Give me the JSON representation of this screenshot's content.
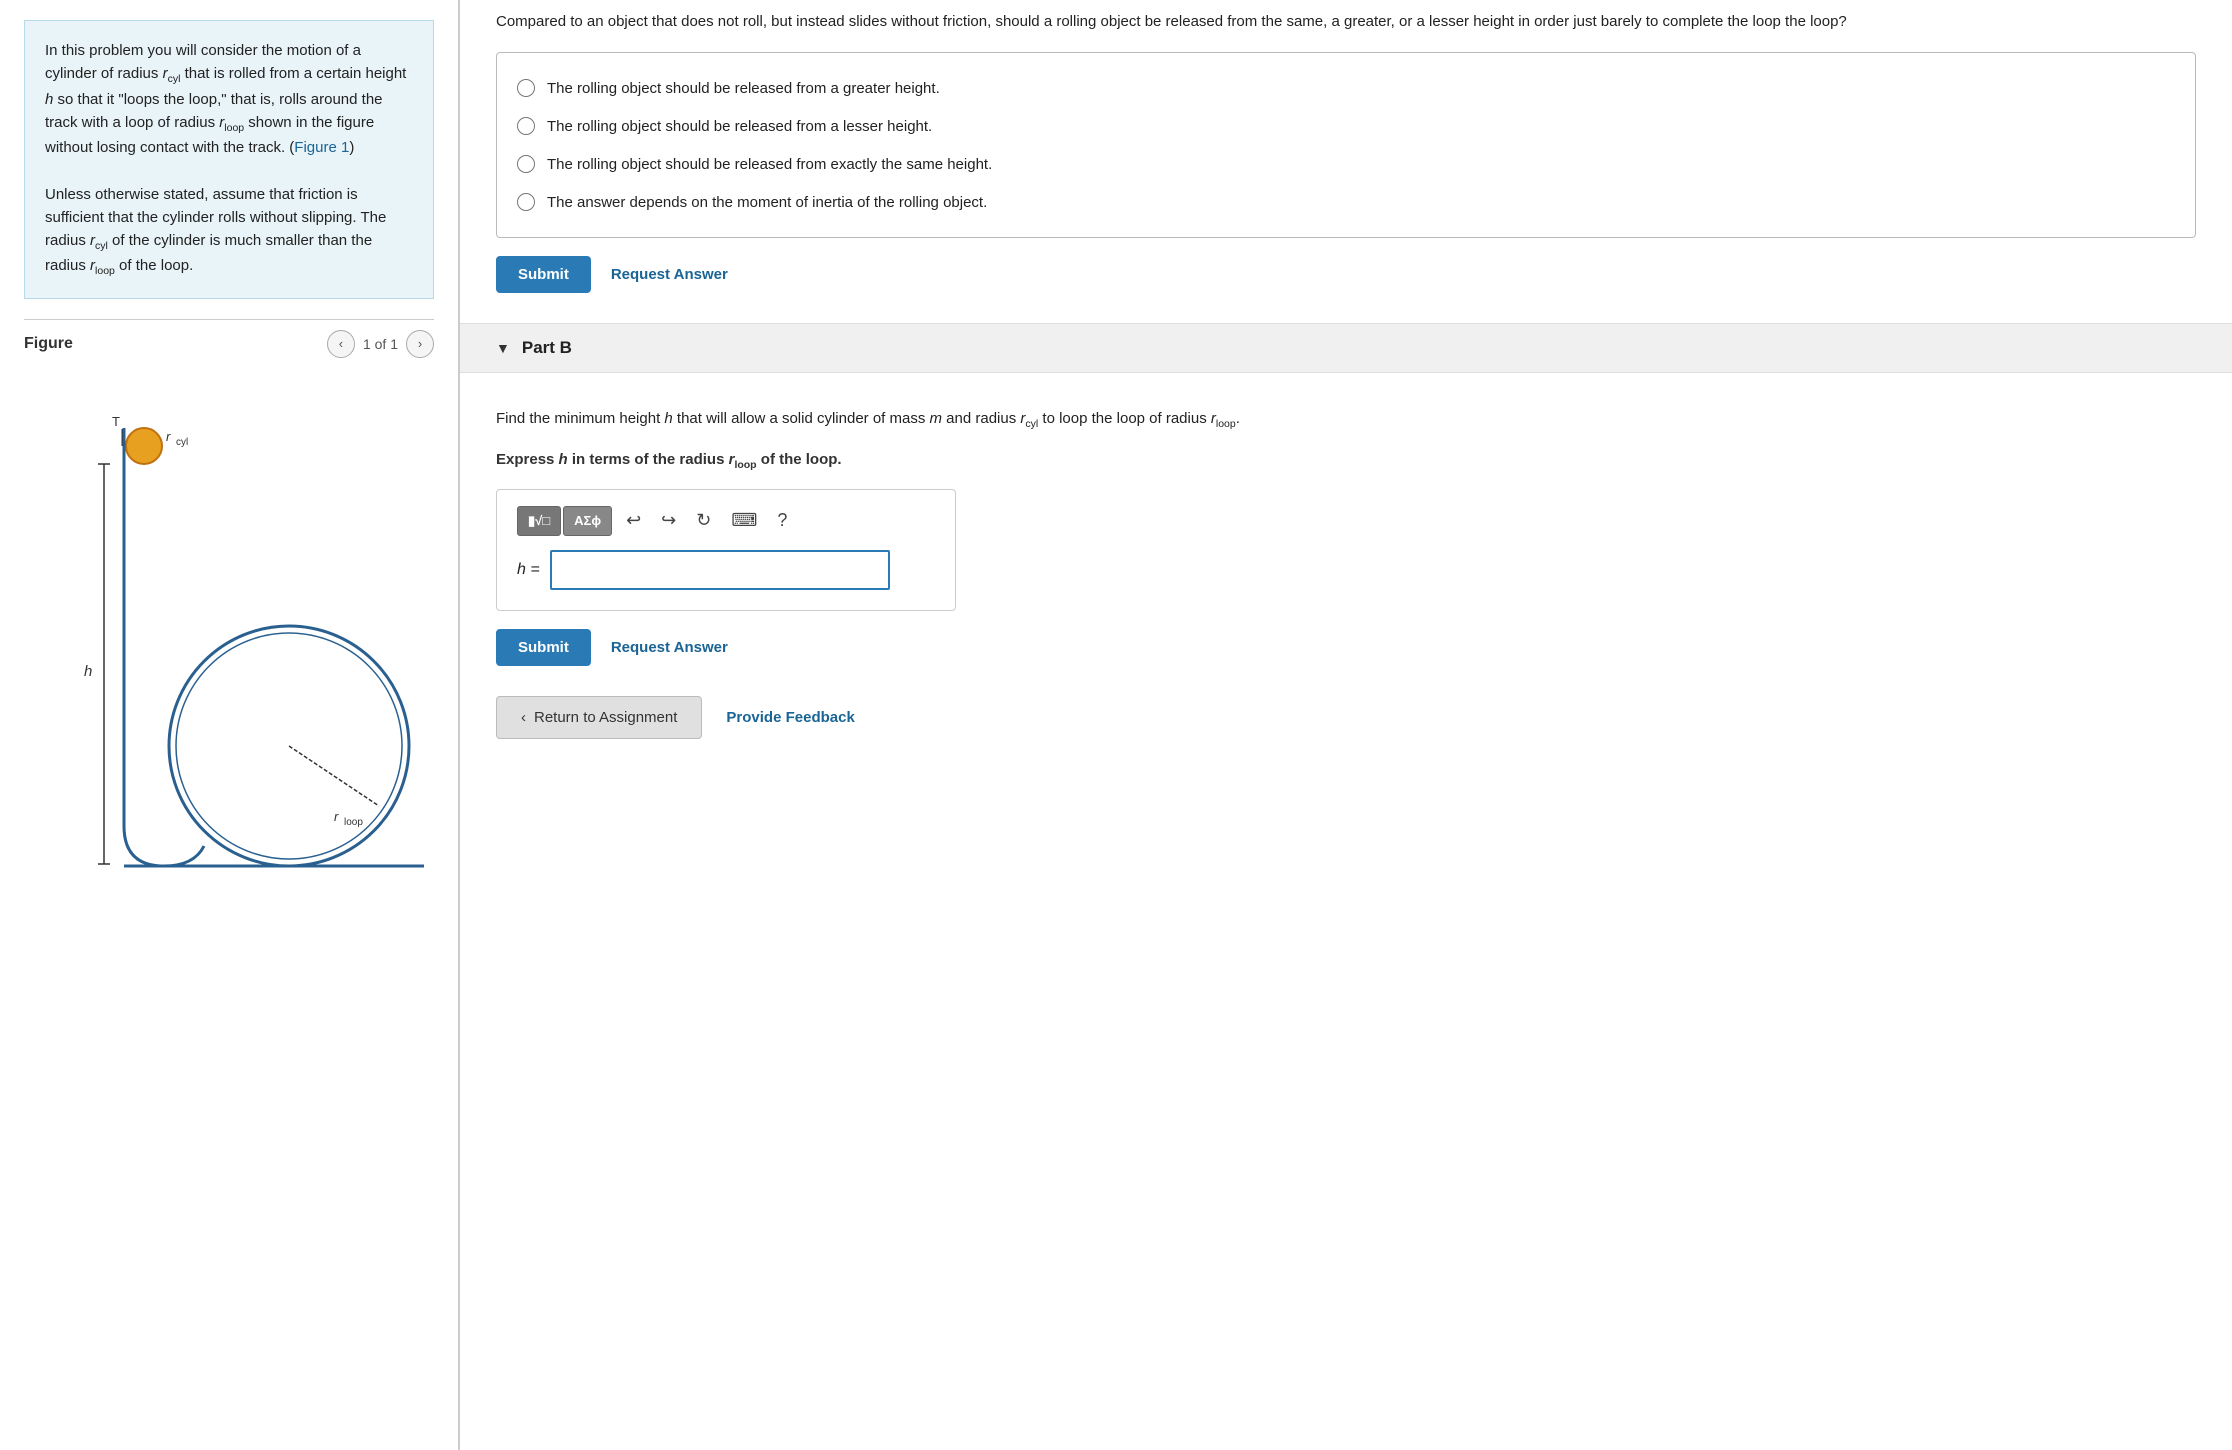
{
  "left": {
    "problem_text_p1": "In this problem you will consider the motion of a cylinder of radius r",
    "sub_cyl": "cyl",
    "problem_text_p1b": " that is rolled from a certain height ",
    "italic_h": "h",
    "problem_text_p1c": " so that it \"loops the loop,\" that is, rolls around the track with a loop of radius r",
    "sub_loop": "loop",
    "problem_text_p1d": " shown in the figure without losing contact with the track. (",
    "figure_link": "Figure 1",
    "problem_text_p1e": ")",
    "problem_text_p2": "Unless otherwise stated, assume that friction is sufficient that the cylinder rolls without slipping. The radius r",
    "sub_cyl2": "cyl",
    "problem_text_p2b": " of the cylinder is much smaller than the radius r",
    "sub_loop2": "loop",
    "problem_text_p2c": " of the loop.",
    "figure_title": "Figure",
    "figure_of": "1 of 1"
  },
  "right": {
    "part_a": {
      "question": "Compared to an object that does not roll, but instead slides without friction, should a rolling object be released from the same, a greater, or a lesser height in order just barely to complete the loop the loop?",
      "options": [
        "The rolling object should be released from a greater height.",
        "The rolling object should be released from a lesser height.",
        "The rolling object should be released from exactly the same height.",
        "The answer depends on the moment of inertia of the rolling object."
      ],
      "submit_label": "Submit",
      "request_answer_label": "Request Answer"
    },
    "part_b": {
      "collapse_arrow": "▼",
      "title": "Part B",
      "question_p1": "Find the minimum height ",
      "italic_h": "h",
      "question_p2": " that will allow a solid cylinder of mass ",
      "italic_m": "m",
      "question_p3": " and radius r",
      "sub_cyl": "cyl",
      "question_p4": " to loop the loop of radius r",
      "sub_loop": "loop",
      "question_p4b": ".",
      "express_bold": "Express ",
      "express_italic_h": "h",
      "express_rest": " in terms of the radius r",
      "express_sub": "loop",
      "express_end": " of the loop.",
      "math_btn_fraction": "√□",
      "math_btn_acs": "ΑΣφ",
      "undo_icon": "↩",
      "redo_icon": "↪",
      "refresh_icon": "↻",
      "keyboard_icon": "⌨",
      "help_icon": "?",
      "h_label": "h =",
      "submit_label": "Submit",
      "request_answer_label": "Request Answer"
    },
    "bottom": {
      "return_arrow": "‹",
      "return_label": "Return to Assignment",
      "feedback_label": "Provide Feedback"
    }
  }
}
